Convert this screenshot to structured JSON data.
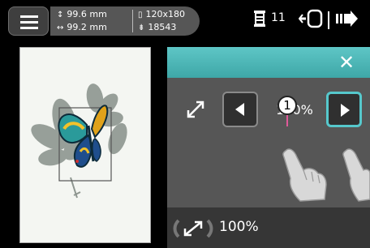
{
  "status": {
    "menu_icon": "hamburger-icon",
    "height_value": "99.6 mm",
    "width_value": "99.2 mm",
    "hoop_size": "120x180",
    "stitch_count": "18543",
    "thread_count": "11",
    "spool_icon": "thread-spool-icon",
    "frame_icon": "hoop-move-icon",
    "next_icon": "next-arrow-icon"
  },
  "panel": {
    "accent": "#4fb8b8",
    "close_icon": "close-icon",
    "scale_value": "100%",
    "callout_number": "1",
    "left_arrow_icon": "triangle-left-icon",
    "right_arrow_icon": "triangle-right-icon",
    "selected_button": "scale-up"
  },
  "footer": {
    "scale_value": "100%"
  }
}
